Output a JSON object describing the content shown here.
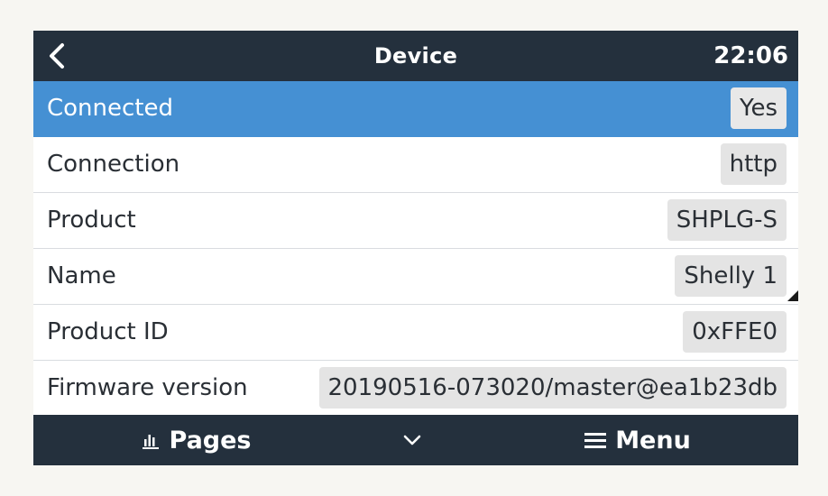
{
  "header": {
    "title": "Device",
    "time": "22:06"
  },
  "rows": [
    {
      "label": "Connected",
      "value": "Yes",
      "selected": true
    },
    {
      "label": "Connection",
      "value": "http"
    },
    {
      "label": "Product",
      "value": "SHPLG-S"
    },
    {
      "label": "Name",
      "value": "Shelly 1",
      "editable": true
    },
    {
      "label": "Product ID",
      "value": "0xFFE0"
    },
    {
      "label": "Firmware version",
      "value": "20190516-073020/master@ea1b23db"
    }
  ],
  "footer": {
    "pages_label": "Pages",
    "menu_label": "Menu"
  },
  "colors": {
    "bar_background": "#24303d",
    "selected_row": "#4590d3",
    "value_chip": "#e4e4e4",
    "page_background": "#f7f6f2"
  },
  "icons": {
    "back": "chevron-left-icon",
    "pages": "bar-chart-icon",
    "down": "chevron-down-icon",
    "menu": "hamburger-icon"
  }
}
